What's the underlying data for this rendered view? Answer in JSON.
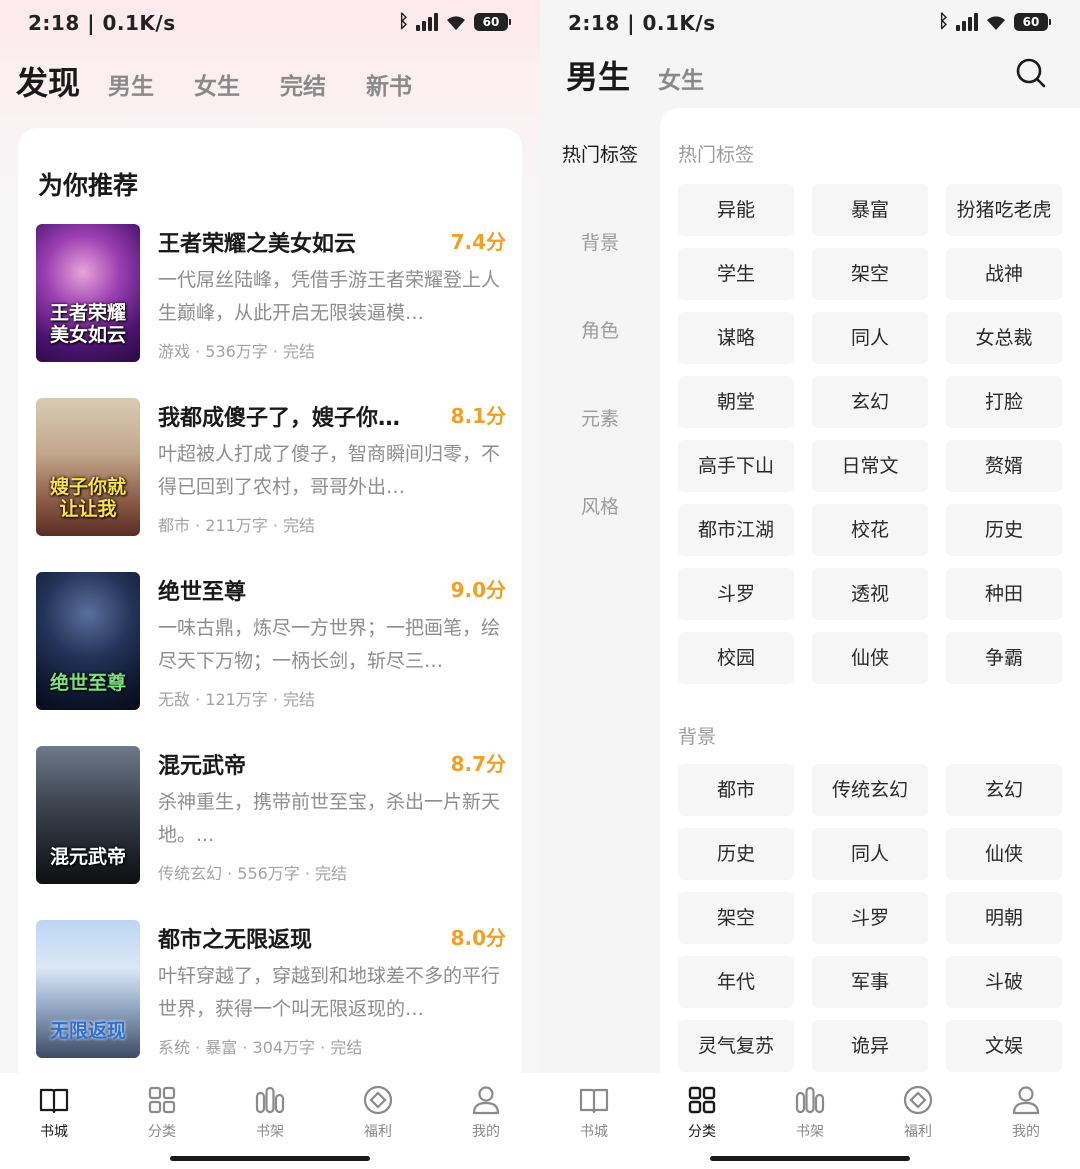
{
  "left": {
    "status": {
      "time": "2:18 | 0.1K/s",
      "battery": "60"
    },
    "tabs": [
      "发现",
      "男生",
      "女生",
      "完结",
      "新书"
    ],
    "section_title": "为你推荐",
    "books": [
      {
        "title": "王者荣耀之美女如云",
        "score": "7.4分",
        "desc": "一代屌丝陆峰，凭借手游王者荣耀登上人生巅峰，从此开启无限装逼模…",
        "meta": "游戏 · 536万字 · 完结",
        "cover_text": "王者荣耀美女如云"
      },
      {
        "title": "我都成傻子了，嫂子你…",
        "score": "8.1分",
        "desc": "叶超被人打成了傻子，智商瞬间归零，不得已回到了农村，哥哥外出…",
        "meta": "都市 · 211万字 · 完结",
        "cover_text": "嫂子你就让让我"
      },
      {
        "title": "绝世至尊",
        "score": "9.0分",
        "desc": "一味古鼎，炼尽一方世界；一把画笔，绘尽天下万物；一柄长剑，斩尽三…",
        "meta": "无敌 · 121万字 · 完结",
        "cover_text": "绝世至尊"
      },
      {
        "title": "混元武帝",
        "score": "8.7分",
        "desc": "杀神重生，携带前世至宝，杀出一片新天地。...",
        "meta": "传统玄幻 · 556万字 · 完结",
        "cover_text": "混元武帝"
      },
      {
        "title": "都市之无限返现",
        "score": "8.0分",
        "desc": "叶轩穿越了，穿越到和地球差不多的平行世界，获得一个叫无限返现的…",
        "meta": "系统 · 暴富 · 304万字 · 完结",
        "cover_text": "无限返现"
      }
    ],
    "nav": [
      "书城",
      "分类",
      "书架",
      "福利",
      "我的"
    ]
  },
  "right": {
    "status": {
      "time": "2:18 | 0.1K/s",
      "battery": "60"
    },
    "tabs": [
      "男生",
      "女生"
    ],
    "side_categories": [
      "热门标签",
      "背景",
      "角色",
      "元素",
      "风格"
    ],
    "sections": [
      {
        "label": "热门标签",
        "tags": [
          "异能",
          "暴富",
          "扮猪吃老虎",
          "学生",
          "架空",
          "战神",
          "谋略",
          "同人",
          "女总裁",
          "朝堂",
          "玄幻",
          "打脸",
          "高手下山",
          "日常文",
          "赘婿",
          "都市江湖",
          "校花",
          "历史",
          "斗罗",
          "透视",
          "种田",
          "校园",
          "仙侠",
          "争霸"
        ]
      },
      {
        "label": "背景",
        "tags": [
          "都市",
          "传统玄幻",
          "玄幻",
          "历史",
          "同人",
          "仙侠",
          "架空",
          "斗罗",
          "明朝",
          "年代",
          "军事",
          "斗破",
          "灵气复苏",
          "诡异",
          "文娱"
        ]
      }
    ],
    "nav": [
      "书城",
      "分类",
      "书架",
      "福利",
      "我的"
    ]
  },
  "colors": {
    "score": "#f0a024",
    "active_text": "#1a1a1a",
    "muted_text": "#8a8a8a",
    "tag_bg": "#f6f6f7"
  },
  "icons": {
    "nav": [
      "book-icon",
      "grid-icon",
      "shelf-icon",
      "welfare-icon",
      "profile-icon"
    ],
    "search": "search-icon"
  }
}
